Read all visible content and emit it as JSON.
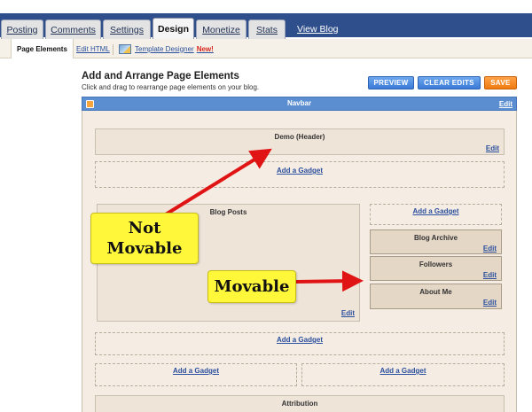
{
  "tabs": [
    {
      "label": "Posting",
      "active": false
    },
    {
      "label": "Comments",
      "active": false
    },
    {
      "label": "Settings",
      "active": false
    },
    {
      "label": "Design",
      "active": true
    },
    {
      "label": "Monetize",
      "active": false
    },
    {
      "label": "Stats",
      "active": false
    }
  ],
  "view_blog_link": "View Blog",
  "subtabs": {
    "page_elements": "Page Elements",
    "edit_html": "Edit HTML",
    "template_designer": "Template Designer",
    "new_badge": "New!"
  },
  "header": {
    "title": "Add and Arrange Page Elements",
    "subtitle": "Click and drag to rearrange page elements on your blog."
  },
  "buttons": {
    "preview": "PREVIEW",
    "clear_edits": "CLEAR EDITS",
    "save": "SAVE"
  },
  "navbar": {
    "label": "Navbar",
    "edit": "Edit"
  },
  "layout": {
    "header_widget": {
      "title": "Demo (Header)",
      "edit": "Edit"
    },
    "add_gadget": "Add a Gadget",
    "blog_posts": {
      "title": "Blog Posts",
      "edit": "Edit"
    },
    "sidebar": [
      {
        "title": "Blog Archive",
        "edit": "Edit"
      },
      {
        "title": "Followers",
        "edit": "Edit"
      },
      {
        "title": "About Me",
        "edit": "Edit"
      }
    ],
    "attribution": {
      "title": "Attribution"
    }
  },
  "annotations": {
    "not_movable_line1": "Not",
    "not_movable_line2": "Movable",
    "movable": "Movable"
  },
  "colors": {
    "tab_strip": "#2f4f8c",
    "navbar": "#5b8ed0",
    "canvas": "#f5ece3",
    "callout": "#fff83a",
    "arrow": "#e01414",
    "save_button": "#ef7a11",
    "primary_button": "#3b7ad6"
  }
}
